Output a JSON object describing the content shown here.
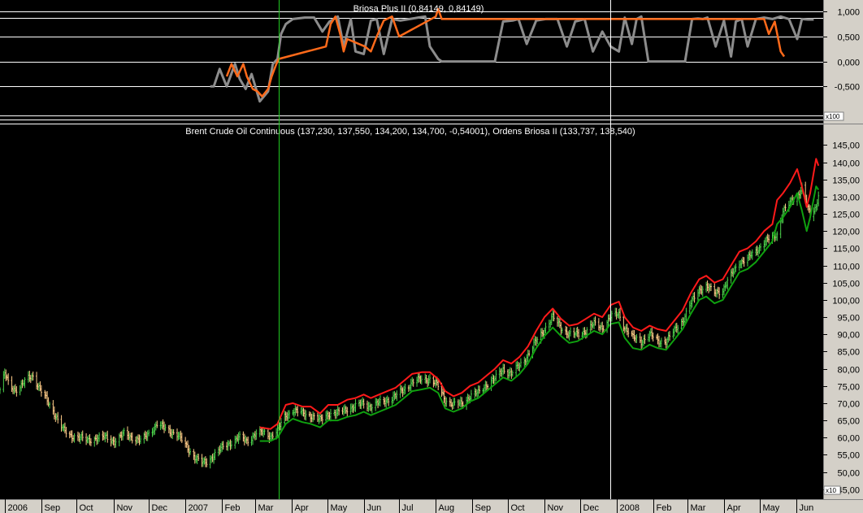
{
  "colors": {
    "background": "#000000",
    "axis_bg": "#d4d0c8",
    "grid": "#ffffff",
    "marker_green": "#22c922",
    "osc_gray": "#8c8c8c",
    "osc_orange": "#ff6a1a",
    "price_up": "#4cd24c",
    "price_down": "#ffcc88",
    "band_upper": "#ff1a1a",
    "band_lower": "#0fa00f"
  },
  "chart_data": [
    {
      "type": "line",
      "title": "Briosa Plus II (0,84149, 0,84149)",
      "axis_note": "x100",
      "ylim": [
        -1.0,
        1.15
      ],
      "yticks": [
        "1,000",
        "0,500",
        "0,000",
        "-0,500"
      ],
      "ytick_values": [
        1.0,
        0.5,
        0.0,
        -0.5
      ],
      "grid": true,
      "series": [
        {
          "color": "gray",
          "x": [
            "2007-01-22",
            "2007-01-25",
            "2007-01-30",
            "2007-02-05",
            "2007-02-12",
            "2007-02-16",
            "2007-02-21",
            "2007-02-26",
            "2007-03-05",
            "2007-03-12",
            "2007-03-16",
            "2007-03-20",
            "2007-03-23",
            "2007-03-27",
            "2007-04-02",
            "2007-04-12",
            "2007-04-20",
            "2007-04-27",
            "2007-05-03",
            "2007-05-10",
            "2007-05-15",
            "2007-05-21",
            "2007-05-25",
            "2007-06-01",
            "2007-06-07",
            "2007-06-12",
            "2007-06-18",
            "2007-06-25",
            "2007-07-02",
            "2007-07-10",
            "2007-07-17",
            "2007-07-23",
            "2007-07-27",
            "2007-08-03",
            "2007-08-06",
            "2007-08-15",
            "2007-08-25",
            "2007-09-05",
            "2007-09-14",
            "2007-09-20",
            "2007-09-27",
            "2007-10-05",
            "2007-10-10",
            "2007-10-17",
            "2007-10-25",
            "2007-11-02",
            "2007-11-12",
            "2007-11-20",
            "2007-11-27",
            "2007-12-05",
            "2007-12-12",
            "2007-12-20",
            "2007-12-27",
            "2008-01-03",
            "2008-01-08",
            "2008-01-14",
            "2008-01-18",
            "2008-01-22",
            "2008-01-28",
            "2008-02-04",
            "2008-02-12",
            "2008-02-20",
            "2008-02-28",
            "2008-03-05",
            "2008-03-10",
            "2008-03-14",
            "2008-03-18",
            "2008-03-25",
            "2008-04-01",
            "2008-04-07",
            "2008-04-11",
            "2008-04-16",
            "2008-04-21",
            "2008-04-28",
            "2008-05-05",
            "2008-05-12",
            "2008-05-19",
            "2008-05-26",
            "2008-06-02",
            "2008-06-06",
            "2008-06-11",
            "2008-06-16"
          ],
          "values": [
            -0.5,
            -0.5,
            -0.15,
            -0.5,
            -0.05,
            -0.35,
            -0.55,
            -0.25,
            -0.8,
            -0.6,
            -0.05,
            0.05,
            0.55,
            0.75,
            0.85,
            0.88,
            0.88,
            0.6,
            0.8,
            0.9,
            0.3,
            0.85,
            0.2,
            0.15,
            0.82,
            0.85,
            0.15,
            0.85,
            0.82,
            0.85,
            0.88,
            0.9,
            0.3,
            0.05,
            0.0,
            0.0,
            0.0,
            0.0,
            0.0,
            0.0,
            0.8,
            0.82,
            0.85,
            0.35,
            0.82,
            0.85,
            0.85,
            0.3,
            0.8,
            0.85,
            0.2,
            0.6,
            0.3,
            0.2,
            0.88,
            0.35,
            0.85,
            0.9,
            0.0,
            0.0,
            0.0,
            0.0,
            0.0,
            0.85,
            0.86,
            0.85,
            0.88,
            0.3,
            0.82,
            0.1,
            0.8,
            0.85,
            0.3,
            0.85,
            0.88,
            0.85,
            0.9,
            0.85,
            0.45,
            0.85,
            0.84,
            0.84
          ]
        },
        {
          "color": "orange",
          "x": [
            "2007-02-05",
            "2007-02-09",
            "2007-02-14",
            "2007-02-19",
            "2007-02-22",
            "2007-02-27",
            "2007-03-03",
            "2007-03-07",
            "2007-03-12",
            "2007-03-15",
            "2007-03-19",
            "2007-03-21",
            "2007-04-30",
            "2007-05-04",
            "2007-05-08",
            "2007-05-12",
            "2007-05-15",
            "2007-05-18",
            "2007-06-02",
            "2007-06-07",
            "2007-06-12",
            "2007-06-18",
            "2007-06-25",
            "2007-07-01",
            "2007-08-01",
            "2007-08-03",
            "2007-08-06",
            "2008-05-05",
            "2008-05-09",
            "2008-05-14",
            "2008-05-19",
            "2008-05-22"
          ],
          "values": [
            -0.3,
            -0.05,
            -0.3,
            -0.05,
            -0.3,
            -0.55,
            -0.6,
            -0.7,
            -0.55,
            -0.3,
            -0.05,
            0.05,
            0.3,
            0.75,
            0.9,
            0.55,
            0.2,
            0.45,
            0.3,
            0.2,
            0.5,
            0.82,
            0.9,
            0.5,
            0.9,
            1.05,
            0.85,
            0.85,
            0.55,
            0.8,
            0.2,
            0.1
          ]
        }
      ]
    },
    {
      "type": "line",
      "title": "Brent Crude Oil Continuous (137,230, 137,550, 134,200, 134,700, -0,54001), Ordens Briosa II (133,737, 138,540)",
      "axis_note": "x10",
      "ylim": [
        44.0,
        146.5
      ],
      "yticks": [
        "145,00",
        "140,00",
        "135,00",
        "130,00",
        "125,00",
        "120,00",
        "115,00",
        "110,00",
        "105,00",
        "100,00",
        "95,00",
        "90,00",
        "85,00",
        "80,00",
        "75,00",
        "70,00",
        "65,00",
        "60,00",
        "55,00",
        "50,00",
        "45,00"
      ],
      "ytick_values": [
        145,
        140,
        135,
        130,
        125,
        120,
        115,
        110,
        105,
        100,
        95,
        90,
        85,
        80,
        75,
        70,
        65,
        60,
        55,
        50,
        45
      ],
      "xticks": [
        "2006",
        "Sep",
        "Oct",
        "Nov",
        "Dec",
        "2007",
        "Feb",
        "Mar",
        "Apr",
        "May",
        "Jun",
        "Jul",
        "Aug",
        "Sep",
        "Oct",
        "Nov",
        "Dec",
        "2008",
        "Feb",
        "Mar",
        "Apr",
        "May",
        "Jun"
      ],
      "xtick_dates": [
        "2006-08-01",
        "2006-09-01",
        "2006-10-01",
        "2006-11-01",
        "2006-12-01",
        "2007-01-01",
        "2007-02-01",
        "2007-03-01",
        "2007-04-01",
        "2007-05-01",
        "2007-06-01",
        "2007-07-01",
        "2007-08-01",
        "2007-09-01",
        "2007-10-01",
        "2007-11-01",
        "2007-12-01",
        "2008-01-01",
        "2008-02-01",
        "2008-03-01",
        "2008-04-01",
        "2008-05-01",
        "2008-06-01"
      ],
      "xlim": [
        "2006-07-28",
        "2008-06-24"
      ],
      "vlines": [
        {
          "date": "2007-03-21",
          "color": "green"
        },
        {
          "date": "2007-12-27",
          "color": "white"
        }
      ],
      "price": {
        "x": [
          "2006-07-28",
          "2006-08-01",
          "2006-08-05",
          "2006-08-10",
          "2006-08-15",
          "2006-08-20",
          "2006-08-25",
          "2006-08-31",
          "2006-09-07",
          "2006-09-14",
          "2006-09-20",
          "2006-09-25",
          "2006-10-01",
          "2006-10-10",
          "2006-10-18",
          "2006-10-25",
          "2006-11-02",
          "2006-11-10",
          "2006-11-18",
          "2006-11-25",
          "2006-12-03",
          "2006-12-08",
          "2006-12-15",
          "2006-12-25",
          "2007-01-05",
          "2007-01-10",
          "2007-01-16",
          "2007-01-20",
          "2007-01-25",
          "2007-02-01",
          "2007-02-08",
          "2007-02-15",
          "2007-02-22",
          "2007-03-01",
          "2007-03-08",
          "2007-03-14",
          "2007-03-20",
          "2007-03-26",
          "2007-04-02",
          "2007-04-10",
          "2007-04-17",
          "2007-04-25",
          "2007-05-02",
          "2007-05-10",
          "2007-05-18",
          "2007-05-25",
          "2007-06-01",
          "2007-06-07",
          "2007-06-14",
          "2007-06-21",
          "2007-06-28",
          "2007-07-05",
          "2007-07-12",
          "2007-07-20",
          "2007-07-27",
          "2007-08-03",
          "2007-08-09",
          "2007-08-16",
          "2007-08-23",
          "2007-08-30",
          "2007-09-06",
          "2007-09-13",
          "2007-09-20",
          "2007-09-27",
          "2007-10-04",
          "2007-10-11",
          "2007-10-18",
          "2007-10-25",
          "2007-11-01",
          "2007-11-08",
          "2007-11-15",
          "2007-11-22",
          "2007-11-29",
          "2007-12-06",
          "2007-12-13",
          "2007-12-20",
          "2007-12-27",
          "2008-01-03",
          "2008-01-08",
          "2008-01-15",
          "2008-01-22",
          "2008-01-29",
          "2008-02-05",
          "2008-02-12",
          "2008-02-19",
          "2008-02-26",
          "2008-03-04",
          "2008-03-11",
          "2008-03-17",
          "2008-03-24",
          "2008-03-31",
          "2008-04-07",
          "2008-04-14",
          "2008-04-21",
          "2008-04-28",
          "2008-05-05",
          "2008-05-12",
          "2008-05-16",
          "2008-05-21",
          "2008-05-27",
          "2008-06-02",
          "2008-06-06",
          "2008-06-10",
          "2008-06-13",
          "2008-06-18",
          "2008-06-20"
        ],
        "values": [
          74,
          78.5,
          75,
          74,
          75,
          77,
          78,
          74,
          70,
          66,
          62,
          60.5,
          60.5,
          59,
          60,
          60,
          59,
          61,
          60,
          59,
          62,
          64,
          62.5,
          61,
          56,
          54,
          52.5,
          53,
          55,
          57,
          58.5,
          60,
          59,
          61,
          61.5,
          60.5,
          62,
          66,
          68,
          67,
          66.5,
          65,
          67,
          67,
          68.5,
          69,
          70,
          69,
          70,
          71,
          72,
          74,
          76,
          77,
          77,
          75,
          71,
          69.5,
          70,
          72,
          73,
          75.5,
          77,
          80,
          78.5,
          81,
          84,
          88,
          91.5,
          95,
          92,
          90,
          90,
          91,
          93,
          92,
          95,
          96,
          92,
          89,
          88,
          90,
          88,
          88,
          91,
          94,
          99,
          103,
          104,
          102,
          103,
          107,
          111,
          112,
          114,
          117,
          118,
          119,
          126,
          128,
          130,
          133,
          128,
          124,
          127,
          131,
          139,
          137
        ]
      },
      "band_upper": {
        "x": [
          "2007-03-05",
          "2007-03-14",
          "2007-03-20",
          "2007-03-27",
          "2007-04-02",
          "2007-04-10",
          "2007-04-17",
          "2007-04-25",
          "2007-05-02",
          "2007-05-10",
          "2007-05-18",
          "2007-05-25",
          "2007-06-01",
          "2007-06-07",
          "2007-06-14",
          "2007-06-21",
          "2007-06-28",
          "2007-07-05",
          "2007-07-12",
          "2007-07-20",
          "2007-07-27",
          "2007-08-03",
          "2007-08-09",
          "2007-08-16",
          "2007-08-23",
          "2007-08-30",
          "2007-09-06",
          "2007-09-13",
          "2007-09-20",
          "2007-09-27",
          "2007-10-04",
          "2007-10-11",
          "2007-10-18",
          "2007-10-25",
          "2007-11-01",
          "2007-11-08",
          "2007-11-15",
          "2007-11-22",
          "2007-11-29",
          "2007-12-06",
          "2007-12-13",
          "2007-12-20",
          "2007-12-27",
          "2008-01-03",
          "2008-01-08",
          "2008-01-15",
          "2008-01-22",
          "2008-01-29",
          "2008-02-05",
          "2008-02-12",
          "2008-02-19",
          "2008-02-26",
          "2008-03-04",
          "2008-03-11",
          "2008-03-17",
          "2008-03-24",
          "2008-03-31",
          "2008-04-07",
          "2008-04-14",
          "2008-04-21",
          "2008-04-28",
          "2008-05-05",
          "2008-05-12",
          "2008-05-16",
          "2008-05-21",
          "2008-05-27",
          "2008-06-02",
          "2008-06-06",
          "2008-06-10",
          "2008-06-13",
          "2008-06-18",
          "2008-06-20"
        ],
        "values": [
          63,
          62.5,
          64,
          69.5,
          70,
          69,
          69,
          67,
          69.5,
          69.5,
          71,
          71.5,
          72.5,
          71.5,
          72.5,
          73.5,
          74.5,
          76.5,
          78.5,
          79,
          79,
          77,
          73.5,
          72,
          73,
          75,
          76,
          78,
          80,
          82.5,
          81.5,
          83.5,
          86.5,
          91,
          95,
          97.5,
          94.5,
          92.5,
          93,
          94.5,
          96,
          95,
          98.5,
          99.5,
          95,
          92,
          91,
          92.5,
          91.5,
          91,
          94,
          97,
          102,
          106,
          107,
          105,
          106,
          110,
          114,
          115,
          117,
          120,
          122,
          129,
          131,
          134,
          138,
          133,
          127,
          131,
          141,
          139
        ]
      },
      "band_lower": {
        "x": [
          "2007-03-05",
          "2007-03-14",
          "2007-03-20",
          "2007-03-27",
          "2007-04-02",
          "2007-04-10",
          "2007-04-17",
          "2007-04-25",
          "2007-05-02",
          "2007-05-10",
          "2007-05-18",
          "2007-05-25",
          "2007-06-01",
          "2007-06-07",
          "2007-06-14",
          "2007-06-21",
          "2007-06-28",
          "2007-07-05",
          "2007-07-12",
          "2007-07-20",
          "2007-07-27",
          "2007-08-03",
          "2007-08-09",
          "2007-08-16",
          "2007-08-23",
          "2007-08-30",
          "2007-09-06",
          "2007-09-13",
          "2007-09-20",
          "2007-09-27",
          "2007-10-04",
          "2007-10-11",
          "2007-10-18",
          "2007-10-25",
          "2007-11-01",
          "2007-11-08",
          "2007-11-15",
          "2007-11-22",
          "2007-11-29",
          "2007-12-06",
          "2007-12-13",
          "2007-12-20",
          "2007-12-27",
          "2008-01-03",
          "2008-01-08",
          "2008-01-15",
          "2008-01-22",
          "2008-01-29",
          "2008-02-05",
          "2008-02-12",
          "2008-02-19",
          "2008-02-26",
          "2008-03-04",
          "2008-03-11",
          "2008-03-17",
          "2008-03-24",
          "2008-03-31",
          "2008-04-07",
          "2008-04-14",
          "2008-04-21",
          "2008-04-28",
          "2008-05-05",
          "2008-05-12",
          "2008-05-16",
          "2008-05-21",
          "2008-05-27",
          "2008-06-02",
          "2008-06-06",
          "2008-06-10",
          "2008-06-13",
          "2008-06-18",
          "2008-06-20"
        ],
        "values": [
          59,
          59,
          60,
          64,
          65.5,
          64.5,
          64,
          63,
          65,
          65,
          66,
          66.5,
          67.5,
          66.5,
          67.5,
          68.5,
          69.5,
          71.5,
          73.5,
          74,
          74.5,
          73,
          68.5,
          67.5,
          68.5,
          70.5,
          71.5,
          73.5,
          75.5,
          77.5,
          76.5,
          78.5,
          81.5,
          86,
          89.5,
          92,
          89.5,
          87.5,
          88,
          89.5,
          91,
          90,
          93,
          93.5,
          89,
          86,
          85.5,
          87,
          86,
          85.5,
          88.5,
          91.5,
          96,
          100,
          101,
          99,
          100,
          104,
          108,
          109,
          111,
          114,
          117,
          122,
          124,
          127,
          131,
          126,
          120,
          124,
          133,
          132
        ]
      }
    }
  ]
}
